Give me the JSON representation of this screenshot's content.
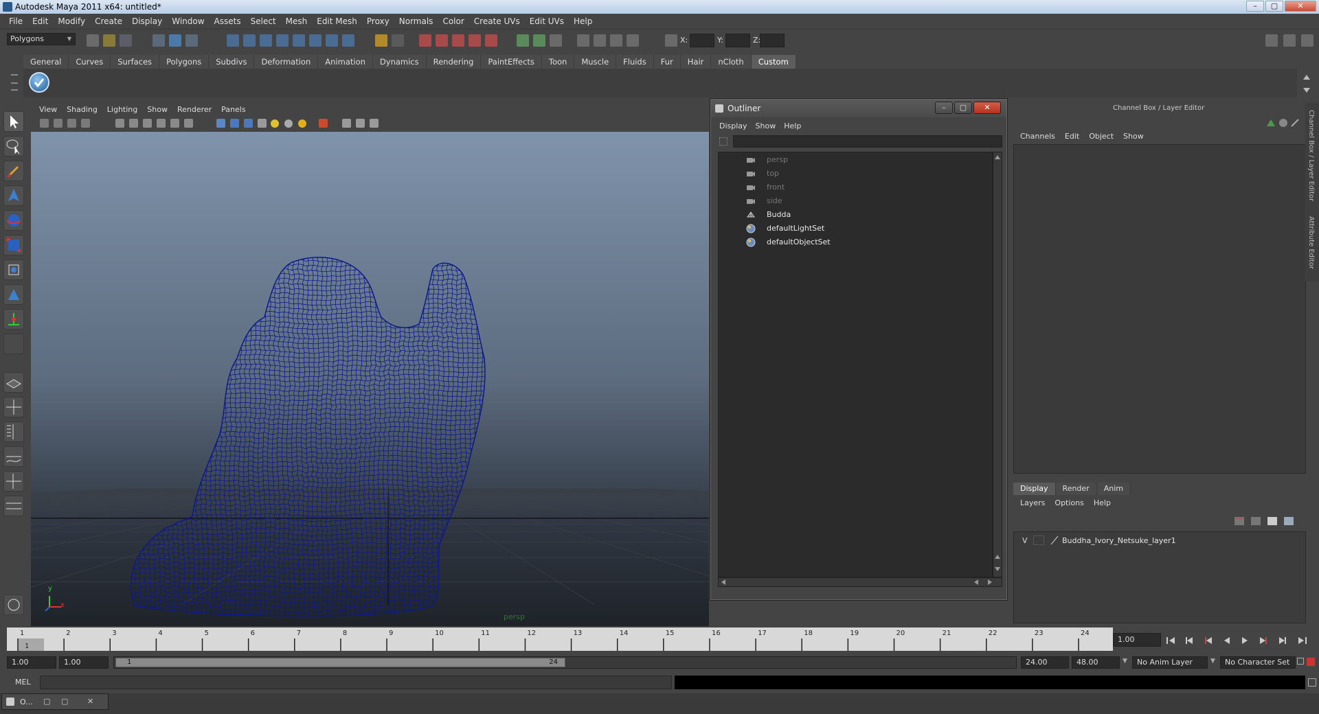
{
  "window": {
    "title": "Autodesk Maya 2011 x64: untitled*",
    "min": "–",
    "max": "▢",
    "close": "✕"
  },
  "menubar": [
    "File",
    "Edit",
    "Modify",
    "Create",
    "Display",
    "Window",
    "Assets",
    "Select",
    "Mesh",
    "Edit Mesh",
    "Proxy",
    "Normals",
    "Color",
    "Create UVs",
    "Edit UVs",
    "Help"
  ],
  "statusline": {
    "mode": "Polygons",
    "x_label": "X:",
    "y_label": "Y:",
    "z_label": "Z:"
  },
  "shelf": {
    "tabs": [
      "General",
      "Curves",
      "Surfaces",
      "Polygons",
      "Subdivs",
      "Deformation",
      "Animation",
      "Dynamics",
      "Rendering",
      "PaintEffects",
      "Toon",
      "Muscle",
      "Fluids",
      "Fur",
      "Hair",
      "nCloth",
      "Custom"
    ],
    "active_tab": "Custom"
  },
  "viewport": {
    "menu": [
      "View",
      "Shading",
      "Lighting",
      "Show",
      "Renderer",
      "Panels"
    ],
    "camera_label": "persp",
    "axis_y": "y",
    "axis_x": "x",
    "wire_color": "#0c1a8c"
  },
  "outliner": {
    "title": "Outliner",
    "menu": [
      "Display",
      "Show",
      "Help"
    ],
    "items": [
      {
        "label": "persp",
        "dim": true,
        "icon": "camera-icon"
      },
      {
        "label": "top",
        "dim": true,
        "icon": "camera-icon"
      },
      {
        "label": "front",
        "dim": true,
        "icon": "camera-icon"
      },
      {
        "label": "side",
        "dim": true,
        "icon": "camera-icon"
      },
      {
        "label": "Budda",
        "dim": false,
        "icon": "mesh-icon"
      },
      {
        "label": "defaultLightSet",
        "dim": false,
        "icon": "set-icon"
      },
      {
        "label": "defaultObjectSet",
        "dim": false,
        "icon": "set-icon"
      }
    ]
  },
  "channel_box": {
    "title": "Channel Box / Layer Editor",
    "menu": [
      "Channels",
      "Edit",
      "Object",
      "Show"
    ],
    "tabs": [
      "Display",
      "Render",
      "Anim"
    ],
    "active_tab": "Display",
    "layer_menu": [
      "Layers",
      "Options",
      "Help"
    ],
    "layer": {
      "visible": "V",
      "name": "Buddha_Ivory_Netsuke_layer1"
    },
    "side_tabs": [
      "Channel Box / Layer Editor",
      "Attribute Editor"
    ]
  },
  "timeline": {
    "ticks": [
      "1",
      "2",
      "3",
      "4",
      "5",
      "6",
      "7",
      "8",
      "9",
      "10",
      "11",
      "12",
      "13",
      "14",
      "15",
      "16",
      "17",
      "18",
      "19",
      "20",
      "21",
      "22",
      "23",
      "24"
    ],
    "current_marker": "1",
    "current_frame": "1.00"
  },
  "range": {
    "start": "1.00",
    "playback_start": "1.00",
    "slider_start": "1",
    "slider_end": "24",
    "playback_end": "24.00",
    "end": "48.00",
    "anim_layer": "No Anim Layer",
    "character_set": "No Character Set"
  },
  "cmdline": {
    "label": "MEL"
  },
  "taskbar": {
    "label": "O..."
  }
}
